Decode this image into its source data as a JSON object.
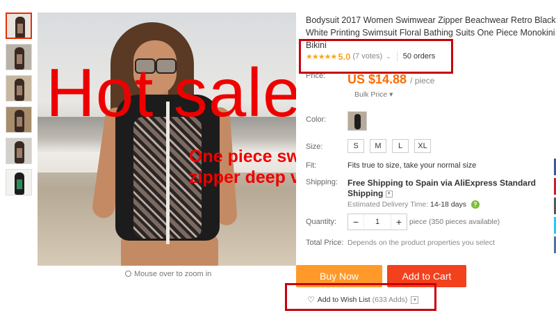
{
  "colors": {
    "accent_red": "#ee0000",
    "price_orange": "#ff6a00",
    "buy_now": "#ff9a2a",
    "add_to_cart": "#f2411c",
    "star": "#f5a623"
  },
  "gallery": {
    "thumbnails": [
      "thumb-1",
      "thumb-2",
      "thumb-3",
      "thumb-4",
      "thumb-5",
      "thumb-6"
    ],
    "overlay_title": "Hot sale",
    "overlay_line1": "One piece swimsuit",
    "overlay_line2": "zipper deep v neck",
    "zoom_hint": "Mouse over to zoom in"
  },
  "product": {
    "title": "Bodysuit 2017 Women Swimwear Zipper Beachwear Retro Black White Printing Swimsuit Floral Bathing Suits One Piece Monokini Bikini",
    "stars": "★★★★★",
    "rating": "5.0",
    "votes": "(7 votes)",
    "orders": "50 orders",
    "price_label": "Price:",
    "price": "US $14.88",
    "price_unit": "/ piece",
    "bulk_price": "Bulk Price ▾",
    "color_label": "Color:",
    "size_label": "Size:",
    "sizes": [
      "S",
      "M",
      "L",
      "XL"
    ],
    "fit_label": "Fit:",
    "fit_text": "Fits true to size, take your normal size",
    "shipping_label": "Shipping:",
    "shipping_text": "Free Shipping to Spain via AliExpress Standard Shipping",
    "delivery_label": "Estimated Delivery Time:",
    "delivery_days": "14-18 days",
    "quantity_label": "Quantity:",
    "quantity_value": "1",
    "quantity_minus": "−",
    "quantity_plus": "+",
    "quantity_note": "piece (350 pieces available)",
    "total_label": "Total Price:",
    "total_text": "Depends on the product properties you select",
    "buy_now": "Buy Now",
    "add_to_cart": "Add to Cart",
    "wish_label": "Add to Wish List",
    "wish_count": "(633 Adds)"
  }
}
